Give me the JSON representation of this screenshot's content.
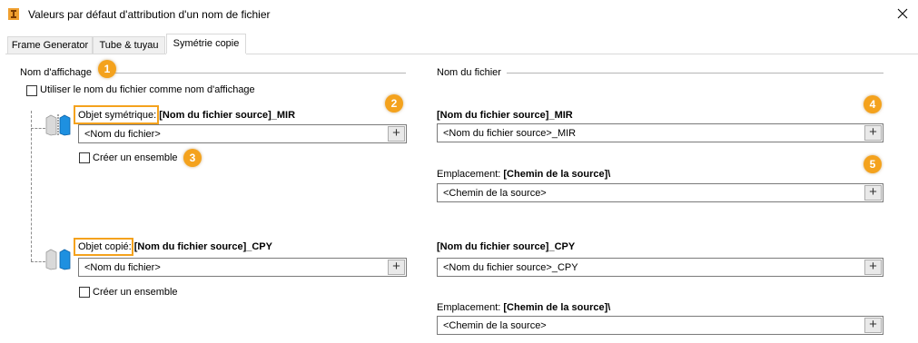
{
  "window": {
    "title": "Valeurs par défaut d'attribution d'un nom de fichier",
    "close_glyph": "✕"
  },
  "tabs": [
    {
      "label": "Frame Generator"
    },
    {
      "label": "Tube & tuyau"
    },
    {
      "label": "Symétrie  copie"
    }
  ],
  "left": {
    "group_title": "Nom d'affichage",
    "use_filename_label": "Utiliser le nom du fichier comme nom d'affichage",
    "mirror": {
      "label": "Objet symétrique:",
      "value": "[Nom du fichier source]_MIR",
      "field_value": "<Nom du fichier>",
      "create_assembly_label": "Créer un ensemble"
    },
    "copy": {
      "label": "Objet copié:",
      "value": "[Nom du fichier source]_CPY",
      "field_value": "<Nom du fichier>",
      "create_assembly_label": "Créer un ensemble"
    }
  },
  "right": {
    "group_title": "Nom du fichier",
    "mirror": {
      "filename_title": "[Nom du fichier source]_MIR",
      "filename_field": "<Nom du fichier source>_MIR",
      "location_label": "Emplacement:",
      "location_value": "[Chemin de la source]\\",
      "location_field": "<Chemin de la source>"
    },
    "copy": {
      "filename_title": "[Nom du fichier source]_CPY",
      "filename_field": "<Nom du fichier source>_CPY",
      "location_label": "Emplacement:",
      "location_value": "[Chemin de la source]\\",
      "location_field": "<Chemin de la source>"
    }
  },
  "plus_glyph": "+",
  "callouts": [
    "1",
    "2",
    "3",
    "4",
    "5"
  ],
  "colors": {
    "callout": "#f4a21d",
    "icon_blue": "#1e90e0",
    "icon_grey": "#bdbdbd"
  }
}
